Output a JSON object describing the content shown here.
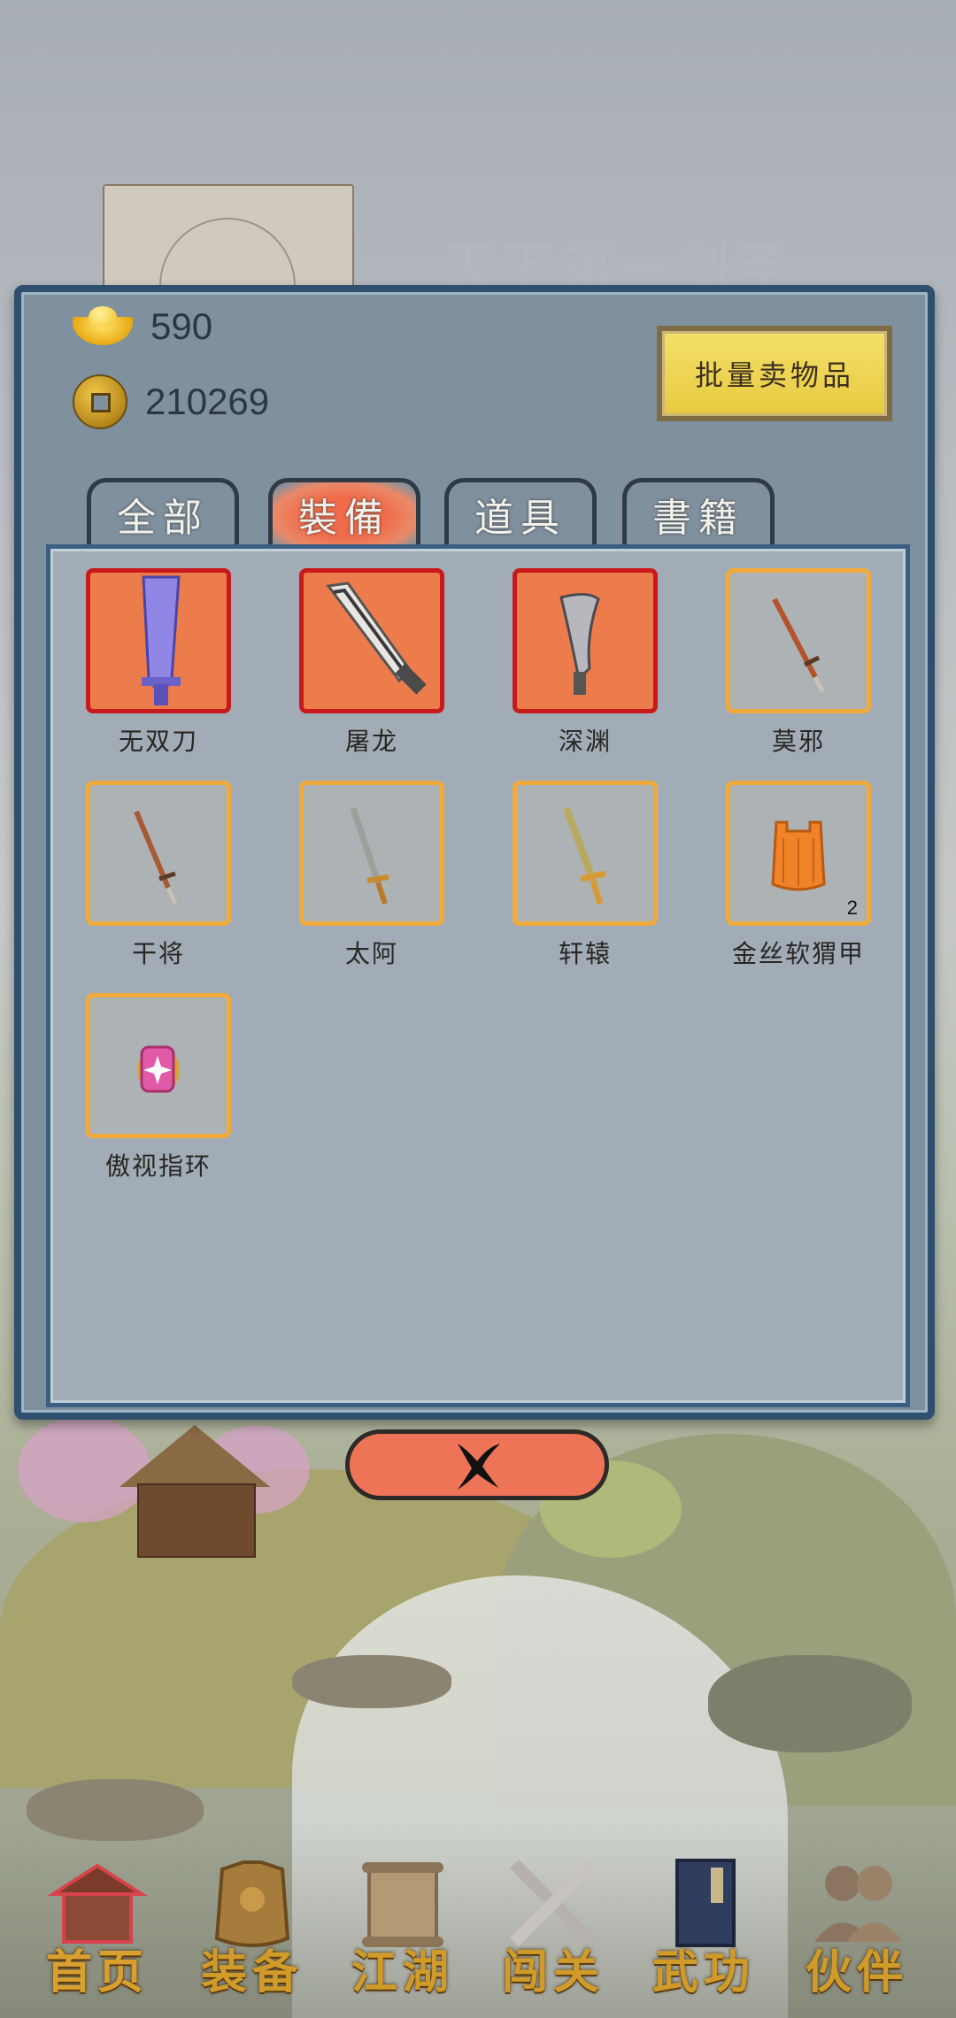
{
  "background": {
    "title": "天下第一剑圣"
  },
  "currency": {
    "ingot": {
      "icon": "gold-ingot-icon",
      "value": "590"
    },
    "coin": {
      "icon": "copper-coin-icon",
      "value": "210269"
    }
  },
  "bulk_sell_label": "批量卖物品",
  "tabs": [
    {
      "label": "全部",
      "active": false
    },
    {
      "label": "裝備",
      "active": true
    },
    {
      "label": "道具",
      "active": false
    },
    {
      "label": "書籍",
      "active": false
    }
  ],
  "items": [
    {
      "name": "无双刀",
      "rarity": "red",
      "icon": "purple-broadsword-icon",
      "count": ""
    },
    {
      "name": "屠龙",
      "rarity": "red",
      "icon": "machete-icon",
      "count": ""
    },
    {
      "name": "深渊",
      "rarity": "red",
      "icon": "curved-dagger-icon",
      "count": ""
    },
    {
      "name": "莫邪",
      "rarity": "orange",
      "icon": "bronze-sword-icon",
      "count": ""
    },
    {
      "name": "干将",
      "rarity": "orange",
      "icon": "bronze-sword-icon",
      "count": ""
    },
    {
      "name": "太阿",
      "rarity": "orange",
      "icon": "gold-sword-icon",
      "count": ""
    },
    {
      "name": "轩辕",
      "rarity": "orange",
      "icon": "gold-sword-icon",
      "count": ""
    },
    {
      "name": "金丝软猬甲",
      "rarity": "orange",
      "icon": "armor-vest-icon",
      "count": "2"
    },
    {
      "name": "傲视指环",
      "rarity": "orange",
      "icon": "ring-icon",
      "count": ""
    }
  ],
  "close_icon": "close-x-icon",
  "nav": [
    {
      "label": "首页",
      "icon": "house-icon",
      "active": true
    },
    {
      "label": "装备",
      "icon": "armor-icon",
      "active": false
    },
    {
      "label": "江湖",
      "icon": "scroll-icon",
      "active": false
    },
    {
      "label": "闯关",
      "icon": "crossed-swords-icon",
      "active": false
    },
    {
      "label": "武功",
      "icon": "book-icon",
      "active": false
    },
    {
      "label": "伙伴",
      "icon": "companions-icon",
      "active": false
    }
  ],
  "colors": {
    "rare_slot_bg": "#ec7c4c",
    "rare_slot_border": "#c8191b",
    "normal_slot_border": "#f2aa3a",
    "active_tab": "#f06b4a",
    "close_button": "#ee7457",
    "nav_label": "#d19b2a"
  }
}
